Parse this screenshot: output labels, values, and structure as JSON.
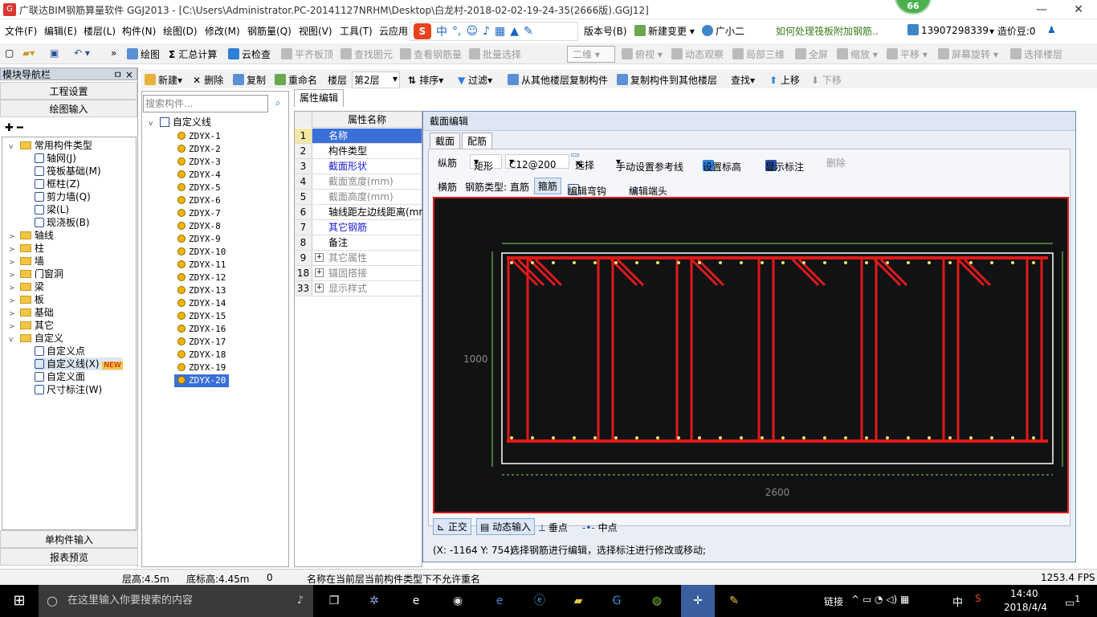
{
  "window": {
    "app_icon_label": "G",
    "title": "广联达BIM钢筋算量软件 GGJ2013 - [C:\\Users\\Administrator.PC-20141127NRHM\\Desktop\\白龙村-2018-02-02-19-24-35(2666版).GGJ12]",
    "badge": "66",
    "min": "—",
    "max": "❐",
    "close": "✕"
  },
  "menubar": {
    "items": [
      "文件(F)",
      "编辑(E)",
      "楼层(L)",
      "构件(N)",
      "绘图(D)",
      "修改(M)",
      "钢筋量(Q)",
      "视图(V)",
      "工具(T)",
      "云应用"
    ],
    "version": "版本号(B)",
    "new_change": "新建变更",
    "guangxiao": "广小二",
    "ad": "如何处理筏板附加钢筋..",
    "phone": "13907298339",
    "price": "造价豆:0"
  },
  "sogou": {
    "zh": "中",
    "dot": "°,"
  },
  "toolbar1": {
    "draw": "绘图",
    "sum": "汇总计算",
    "cloud_check": "云检查",
    "flat": "平齐板顶",
    "find": "查找图元",
    "view_rebar": "查看钢筋量",
    "batch": "批量选择",
    "dim": "二维",
    "top_view": "俯视",
    "dyn": "动态观察",
    "local3d": "局部三维",
    "full": "全屏",
    "zoom": "缩放",
    "pan": "平移",
    "rotate": "屏幕旋转",
    "select_floor": "选择楼层"
  },
  "toolbar2": {
    "new": "新建",
    "delete": "删除",
    "copy": "复制",
    "rename": "重命名",
    "floor_label": "楼层",
    "floor": "第2层",
    "sort": "排序",
    "filter": "过滤",
    "copy_from": "从其他楼层复制构件",
    "copy_to": "复制构件到其他楼层",
    "find": "查找",
    "up": "上移",
    "down": "下移"
  },
  "nav": {
    "header": "模块导航栏",
    "pin": "ㅁ ×",
    "btn_project": "工程设置",
    "btn_draw": "绘图输入",
    "btn_single": "单构件输入",
    "btn_report": "报表预览",
    "tree": [
      {
        "label": "常用构件类型",
        "level": 0,
        "type": "folder",
        "expand": "v"
      },
      {
        "label": "轴网(J)",
        "level": 1
      },
      {
        "label": "筏板基础(M)",
        "level": 1
      },
      {
        "label": "框柱(Z)",
        "level": 1
      },
      {
        "label": "剪力墙(Q)",
        "level": 1
      },
      {
        "label": "梁(L)",
        "level": 1
      },
      {
        "label": "现浇板(B)",
        "level": 1
      },
      {
        "label": "轴线",
        "level": 0,
        "type": "folder",
        "expand": ">"
      },
      {
        "label": "柱",
        "level": 0,
        "type": "folder",
        "expand": ">"
      },
      {
        "label": "墙",
        "level": 0,
        "type": "folder",
        "expand": ">"
      },
      {
        "label": "门窗洞",
        "level": 0,
        "type": "folder",
        "expand": ">"
      },
      {
        "label": "梁",
        "level": 0,
        "type": "folder",
        "expand": ">"
      },
      {
        "label": "板",
        "level": 0,
        "type": "folder",
        "expand": ">"
      },
      {
        "label": "基础",
        "level": 0,
        "type": "folder",
        "expand": ">"
      },
      {
        "label": "其它",
        "level": 0,
        "type": "folder",
        "expand": ">"
      },
      {
        "label": "自定义",
        "level": 0,
        "type": "folder",
        "expand": "v"
      },
      {
        "label": "自定义点",
        "level": 1
      },
      {
        "label": "自定义线(X)",
        "level": 1,
        "tag": "NEW"
      },
      {
        "label": "自定义面",
        "level": 1
      },
      {
        "label": "尺寸标注(W)",
        "level": 1
      }
    ]
  },
  "components": {
    "search_placeholder": "搜索构件...",
    "root": "自定义线",
    "items": [
      "ZDYX-1",
      "ZDYX-2",
      "ZDYX-3",
      "ZDYX-4",
      "ZDYX-5",
      "ZDYX-6",
      "ZDYX-7",
      "ZDYX-8",
      "ZDYX-9",
      "ZDYX-10",
      "ZDYX-11",
      "ZDYX-12",
      "ZDYX-13",
      "ZDYX-14",
      "ZDYX-15",
      "ZDYX-16",
      "ZDYX-17",
      "ZDYX-18",
      "ZDYX-19",
      "ZDYX-20"
    ],
    "selected": "ZDYX-20"
  },
  "props": {
    "tab": "属性编辑",
    "header": "属性名称",
    "rows": [
      {
        "num": "1",
        "name": "名称",
        "style": "sel"
      },
      {
        "num": "2",
        "name": "构件类型",
        "style": ""
      },
      {
        "num": "3",
        "name": "截面形状",
        "style": "blue"
      },
      {
        "num": "4",
        "name": "截面宽度(mm)",
        "style": "gray"
      },
      {
        "num": "5",
        "name": "截面高度(mm)",
        "style": "gray"
      },
      {
        "num": "6",
        "name": "轴线距左边线距离(mm",
        "style": ""
      },
      {
        "num": "7",
        "name": "其它钢筋",
        "style": "blue"
      },
      {
        "num": "8",
        "name": "备注",
        "style": ""
      },
      {
        "num": "9",
        "name": "其它属性",
        "style": "gray",
        "plus": true
      },
      {
        "num": "18",
        "name": "锚固搭接",
        "style": "gray",
        "plus": true
      },
      {
        "num": "33",
        "name": "显示样式",
        "style": "gray",
        "plus": true
      }
    ]
  },
  "dialog": {
    "title": "截面编辑",
    "tab_section": "截面",
    "tab_rebar": "配筋",
    "long_label": "纵筋",
    "shape": "矩形",
    "spec": "C12@200",
    "select": "选择",
    "ref_line": "手动设置参考线",
    "set_elev": "设置标高",
    "show_dim": "显示标注",
    "del": "删除",
    "hoop_label": "横筋",
    "rebar_type": "钢筋类型:",
    "straight": "直筋",
    "stirrup": "箍筋",
    "edit_hook": "编辑弯钩",
    "edit_end": "编辑端头",
    "dim_width": "2600",
    "dim_height": "1000",
    "ortho": "正交",
    "dyn_input": "动态输入",
    "perp": "垂点",
    "mid": "中点",
    "coords": "(X: -1164 Y: 754)",
    "hint": "选择钢筋进行编辑，选择标注进行修改或移动;",
    "colors": {
      "canvas": "#111214",
      "rebar": "#e01a1a",
      "border": "#d81b1b",
      "dim": "#7ed957",
      "node": "#e8e36a"
    }
  },
  "statusbar": {
    "floor_h": "层高:4.5m",
    "bottom_h": "底标高:4.45m",
    "zero": "0",
    "msg": "名称在当前层当前构件类型下不允许重名",
    "fps": "1253.4 FPS"
  },
  "taskbar": {
    "search_placeholder": "在这里输入你要搜索的内容",
    "link": "链接",
    "ime": "中",
    "time": "14:40",
    "date": "2018/4/4",
    "notif": "1"
  }
}
